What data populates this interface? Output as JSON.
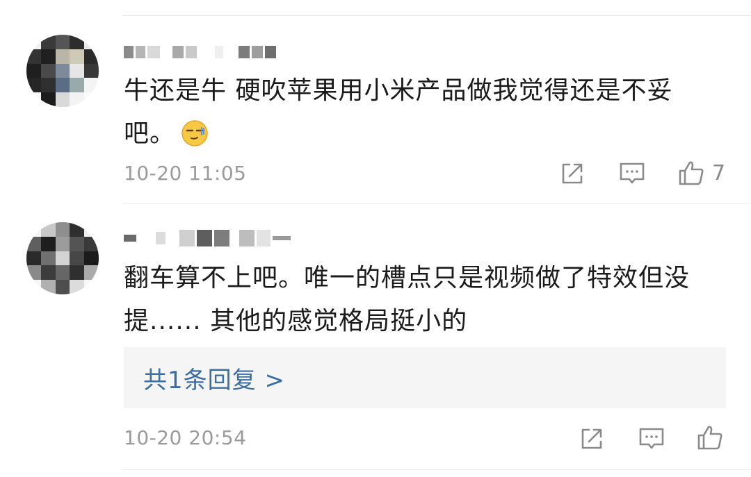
{
  "comments": [
    {
      "username": "",
      "text_line1": "牛还是牛 硬吹苹果用小米产品做我觉得还是不妥",
      "text_line2": "吧。",
      "emoji": "smirk-emoji",
      "time": "10-20 11:05",
      "like_count": "7",
      "icons": [
        "share-icon",
        "comment-icon",
        "thumbs-up-icon"
      ]
    },
    {
      "username": "",
      "text_line1": "翻车算不上吧。唯一的槽点只是视频做了特效但没",
      "text_line2": "提...... 其他的感觉格局挺小的",
      "reply_link": "共1条回复 >",
      "time": "10-20 20:54",
      "like_count": "",
      "icons": [
        "share-icon",
        "comment-icon",
        "thumbs-up-icon"
      ]
    }
  ],
  "colors": {
    "link": "#3a6ea5",
    "timestamp": "#9b9b9b",
    "icon": "#8a8a8a",
    "reply_bg": "#f5f5f5"
  }
}
